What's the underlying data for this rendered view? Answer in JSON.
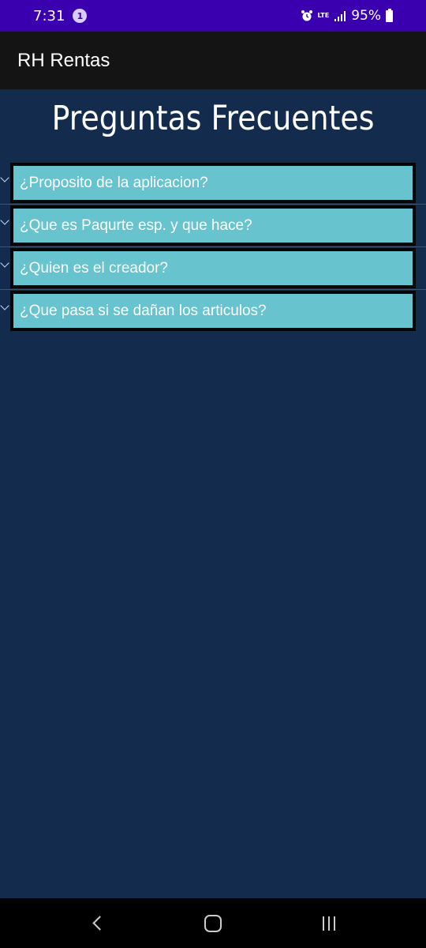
{
  "status_bar": {
    "time": "7:31",
    "notification_count": "1",
    "network_label": "LTE",
    "battery_percent": "95%"
  },
  "app_bar": {
    "title": "RH Rentas"
  },
  "page": {
    "title": "Preguntas Frecuentes"
  },
  "faq": {
    "items": [
      {
        "label": "¿Proposito de la aplicacion?"
      },
      {
        "label": "¿Que es Paqurte esp. y que hace?"
      },
      {
        "label": "¿Quien es el creador?"
      },
      {
        "label": "¿Que pasa si se dañan los articulos?"
      }
    ]
  },
  "colors": {
    "status_bar": "#3a00b0",
    "app_bar": "#141414",
    "background": "#132b4c",
    "faq_item": "#67c3cd"
  }
}
